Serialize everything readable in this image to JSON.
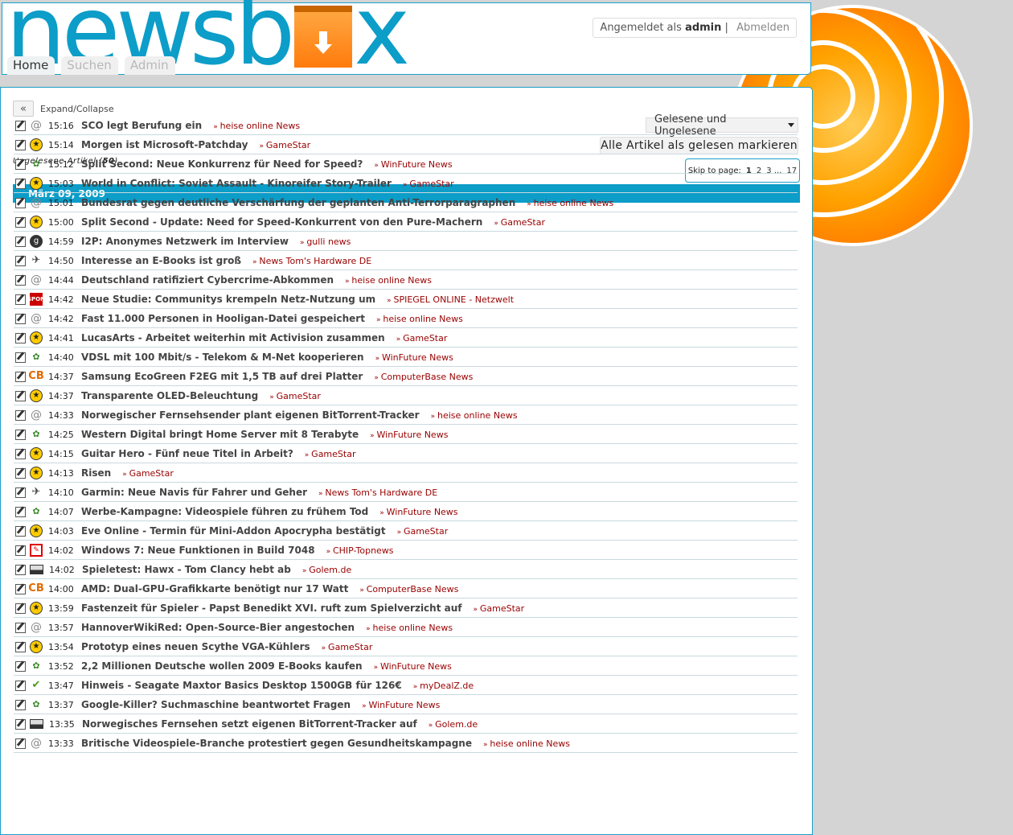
{
  "header": {
    "logo_text_left": "newsb",
    "logo_text_right": "x",
    "login_prefix": "Angemeldet als",
    "login_user": "admin",
    "login_sep": "|",
    "logout_label": "Abmelden",
    "nav": [
      {
        "label": "Home"
      },
      {
        "label": "Suchen"
      },
      {
        "label": "Admin"
      }
    ]
  },
  "main": {
    "expand_icon": "«",
    "expand_label": "Expand/Collapse",
    "filter_value": "Gelesene und Ungelesene",
    "mark_all_label": "Alle Artikel als gelesen markieren",
    "unread_label": "Ungelesene Artikel",
    "unread_count": "50",
    "pager": {
      "label": "Skip to page:",
      "current": "1",
      "p2": "2",
      "p3": "3",
      "ellipsis": "...",
      "last": "17"
    },
    "date_header": "März 09, 2009"
  },
  "articles": [
    {
      "time": "15:16",
      "title": "SCO legt Berufung ein",
      "source": "heise online News",
      "icon": "heise"
    },
    {
      "time": "15:14",
      "title": "Morgen ist Microsoft-Patchday",
      "source": "GameStar",
      "icon": "gamestar"
    },
    {
      "time": "15:12",
      "title": "Split Second: Neue Konkurrenz für Need for Speed?",
      "source": "WinFuture News",
      "icon": "winfuture"
    },
    {
      "time": "15:03",
      "title": "World in Conflict: Soviet Assault - Kinoreifer Story-Trailer",
      "source": "GameStar",
      "icon": "gamestar"
    },
    {
      "time": "15:01",
      "title": "Bundesrat gegen deutliche Verschärfung der geplanten Anti-Terrorparagraphen",
      "source": "heise online News",
      "icon": "heise"
    },
    {
      "time": "15:00",
      "title": "Split Second - Update: Need for Speed-Konkurrent von den Pure-Machern",
      "source": "GameStar",
      "icon": "gamestar"
    },
    {
      "time": "14:59",
      "title": "I2P: Anonymes Netzwerk im Interview",
      "source": "gulli news",
      "icon": "gulli"
    },
    {
      "time": "14:50",
      "title": "Interesse an E-Books ist groß",
      "source": "News Tom's Hardware DE",
      "icon": "toms"
    },
    {
      "time": "14:44",
      "title": "Deutschland ratifiziert Cybercrime-Abkommen",
      "source": "heise online News",
      "icon": "heise"
    },
    {
      "time": "14:42",
      "title": "Neue Studie: Communitys krempeln Netz-Nutzung um",
      "source": "SPIEGEL ONLINE - Netzwelt",
      "icon": "spiegel"
    },
    {
      "time": "14:42",
      "title": "Fast 11.000 Personen in Hooligan-Datei gespeichert",
      "source": "heise online News",
      "icon": "heise"
    },
    {
      "time": "14:41",
      "title": "LucasArts - Arbeitet weiterhin mit Activision zusammen",
      "source": "GameStar",
      "icon": "gamestar"
    },
    {
      "time": "14:40",
      "title": "VDSL mit 100 Mbit/s - Telekom & M-Net kooperieren",
      "source": "WinFuture News",
      "icon": "winfuture"
    },
    {
      "time": "14:37",
      "title": "Samsung EcoGreen F2EG mit 1,5 TB auf drei Platter",
      "source": "ComputerBase News",
      "icon": "computerbase"
    },
    {
      "time": "14:37",
      "title": "Transparente OLED-Beleuchtung",
      "source": "GameStar",
      "icon": "gamestar"
    },
    {
      "time": "14:33",
      "title": "Norwegischer Fernsehsender plant eigenen BitTorrent-Tracker",
      "source": "heise online News",
      "icon": "heise"
    },
    {
      "time": "14:25",
      "title": "Western Digital bringt Home Server mit 8 Terabyte",
      "source": "WinFuture News",
      "icon": "winfuture"
    },
    {
      "time": "14:15",
      "title": "Guitar Hero - Fünf neue Titel in Arbeit?",
      "source": "GameStar",
      "icon": "gamestar"
    },
    {
      "time": "14:13",
      "title": "Risen",
      "source": "GameStar",
      "icon": "gamestar"
    },
    {
      "time": "14:10",
      "title": "Garmin: Neue Navis für Fahrer und Geher",
      "source": "News Tom's Hardware DE",
      "icon": "toms"
    },
    {
      "time": "14:07",
      "title": "Werbe-Kampagne: Videospiele führen zu frühem Tod",
      "source": "WinFuture News",
      "icon": "winfuture"
    },
    {
      "time": "14:03",
      "title": "Eve Online - Termin für Mini-Addon Apocrypha bestätigt",
      "source": "GameStar",
      "icon": "gamestar"
    },
    {
      "time": "14:02",
      "title": "Windows 7: Neue Funktionen in Build 7048",
      "source": "CHIP-Topnews",
      "icon": "chip"
    },
    {
      "time": "14:02",
      "title": "Spieletest: Hawx - Tom Clancy hebt ab",
      "source": "Golem.de",
      "icon": "golem"
    },
    {
      "time": "14:00",
      "title": "AMD: Dual-GPU-Grafikkarte benötigt nur 17 Watt",
      "source": "ComputerBase News",
      "icon": "computerbase"
    },
    {
      "time": "13:59",
      "title": "Fastenzeit für Spieler - Papst Benedikt XVI. ruft zum Spielverzicht auf",
      "source": "GameStar",
      "icon": "gamestar"
    },
    {
      "time": "13:57",
      "title": "HannoverWikiRed: Open-Source-Bier angestochen",
      "source": "heise online News",
      "icon": "heise"
    },
    {
      "time": "13:54",
      "title": "Prototyp eines neuen Scythe VGA-Kühlers",
      "source": "GameStar",
      "icon": "gamestar"
    },
    {
      "time": "13:52",
      "title": "2,2 Millionen Deutsche wollen 2009 E-Books kaufen",
      "source": "WinFuture News",
      "icon": "winfuture"
    },
    {
      "time": "13:47",
      "title": "Hinweis - Seagate Maxtor Basics Desktop 1500GB für 126€",
      "source": "myDealZ.de",
      "icon": "mydealz"
    },
    {
      "time": "13:37",
      "title": "Google-Killer? Suchmaschine beantwortet Fragen",
      "source": "WinFuture News",
      "icon": "winfuture"
    },
    {
      "time": "13:35",
      "title": "Norwegisches Fernsehen setzt eigenen BitTorrent-Tracker auf",
      "source": "Golem.de",
      "icon": "golem"
    },
    {
      "time": "13:33",
      "title": "Britische Videospiele-Branche protestiert gegen Gesundheitskampagne",
      "source": "heise online News",
      "icon": "heise"
    }
  ],
  "icon_glyphs": {
    "heise": "@",
    "gamestar": "★",
    "winfuture": "✿",
    "gulli": "g",
    "toms": "✈",
    "spiegel": "SPON",
    "computerbase": "CB",
    "chip": "✎",
    "golem": "",
    "mydealz": "✔"
  }
}
